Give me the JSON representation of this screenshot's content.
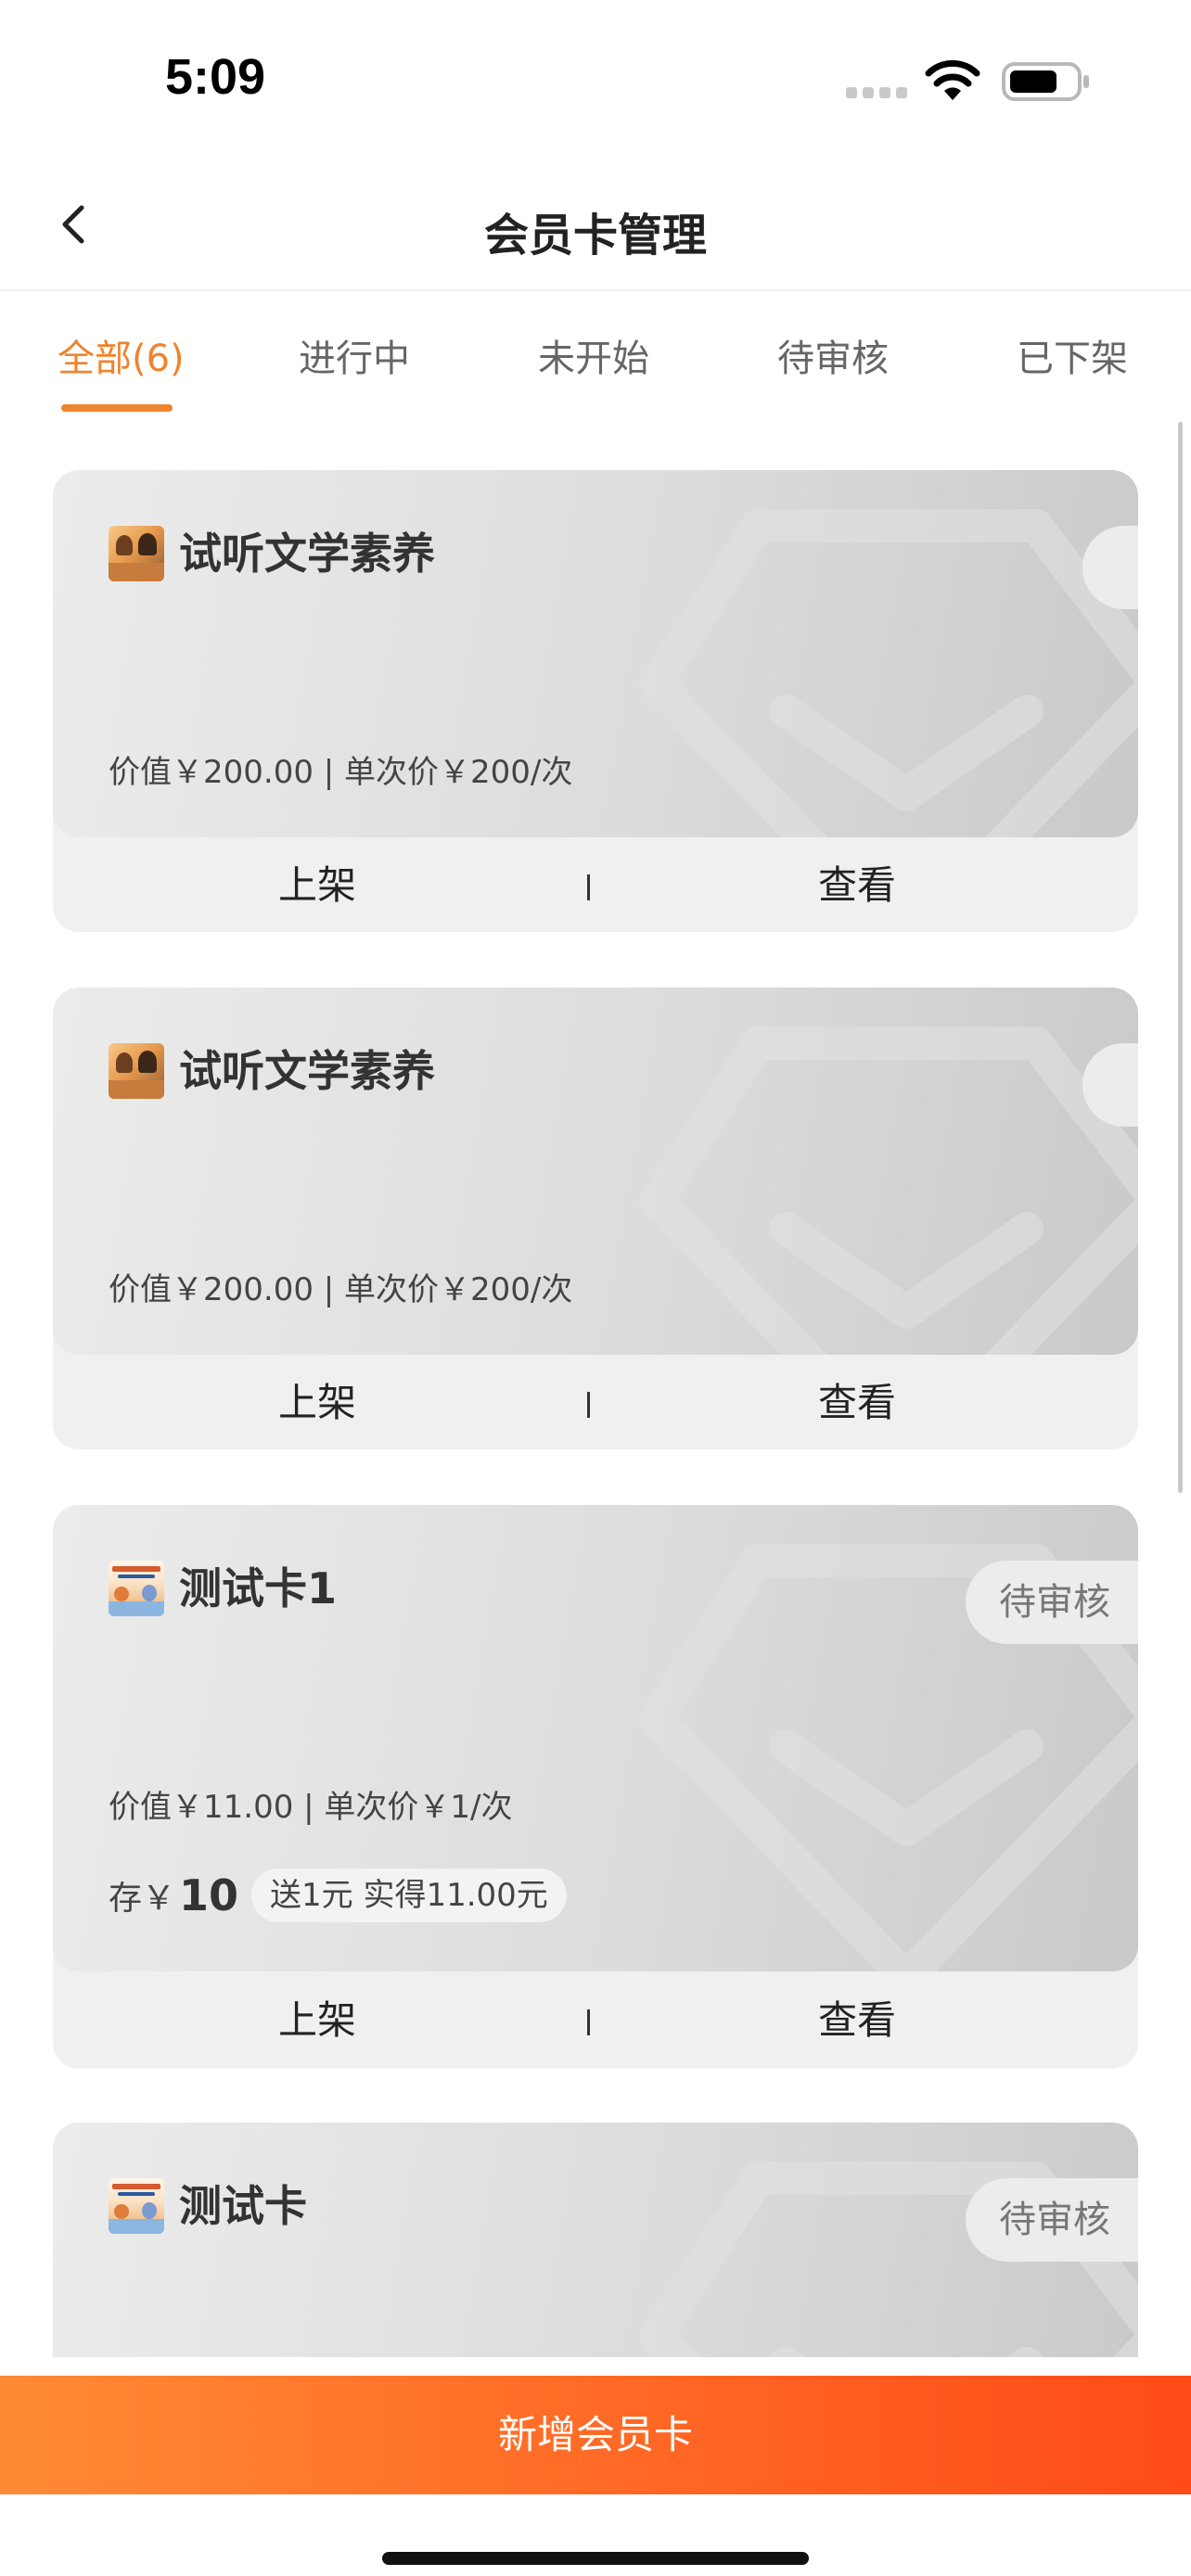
{
  "status_bar": {
    "time": "5:09"
  },
  "header": {
    "title": "会员卡管理"
  },
  "tabs": [
    {
      "label": "全部(6)",
      "active": true
    },
    {
      "label": "进行中",
      "active": false
    },
    {
      "label": "未开始",
      "active": false
    },
    {
      "label": "待审核",
      "active": false
    },
    {
      "label": "已下架",
      "active": false
    }
  ],
  "cards": [
    {
      "name": "试听文学素养",
      "status": "",
      "price_line": "价值￥200.00 | 单次价￥200/次",
      "action_left": "上架",
      "action_right": "查看"
    },
    {
      "name": "试听文学素养",
      "status": "",
      "price_line": "价值￥200.00 | 单次价￥200/次",
      "action_left": "上架",
      "action_right": "查看"
    },
    {
      "name": "测试卡1",
      "status": "待审核",
      "price_line": "价值￥11.00 | 单次价￥1/次",
      "deposit_prefix": "存￥",
      "deposit_amount": "10",
      "deposit_note": "送1元 实得11.00元",
      "action_left": "上架",
      "action_right": "查看"
    },
    {
      "name": "测试卡",
      "status": "待审核"
    }
  ],
  "footer": {
    "add_button": "新增会员卡"
  },
  "colors": {
    "accent": "#f0832d",
    "button_start": "#ff8a35",
    "button_end": "#ff4b17"
  }
}
